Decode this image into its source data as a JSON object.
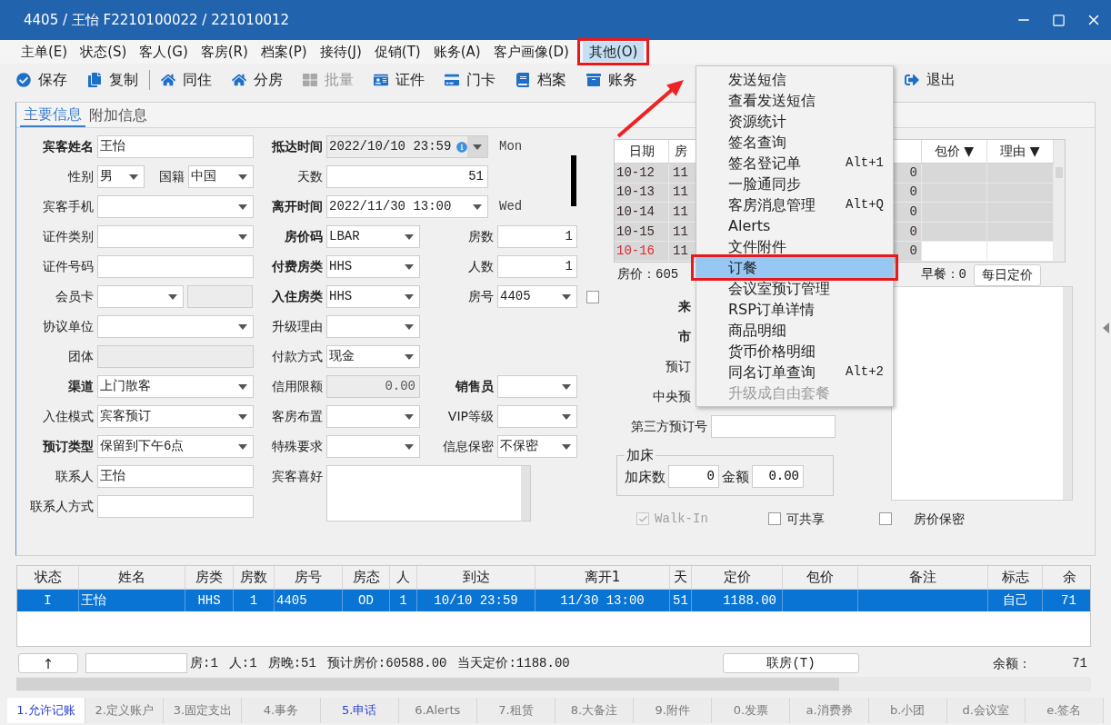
{
  "window": {
    "title": "4405 / 王怡 F2210100022 / 221010012"
  },
  "menu_bar": [
    {
      "label": "主单(E)",
      "selected": false,
      "callout": false
    },
    {
      "label": "状态(S)",
      "selected": false,
      "callout": false
    },
    {
      "label": "客人(G)",
      "selected": false,
      "callout": false
    },
    {
      "label": "客房(R)",
      "selected": false,
      "callout": false
    },
    {
      "label": "档案(P)",
      "selected": false,
      "callout": false
    },
    {
      "label": "接待(J)",
      "selected": false,
      "callout": false
    },
    {
      "label": "促销(T)",
      "selected": false,
      "callout": false
    },
    {
      "label": "账务(A)",
      "selected": false,
      "callout": false
    },
    {
      "label": "客户画像(D)",
      "selected": false,
      "callout": false
    },
    {
      "label": "其他(O)",
      "selected": true,
      "callout": true
    }
  ],
  "toolbar": [
    {
      "kind": "save",
      "label": "保存",
      "disabled": false,
      "separator_after": false
    },
    {
      "kind": "copy",
      "label": "复制",
      "disabled": false,
      "separator_after": true
    },
    {
      "kind": "share",
      "label": "同住",
      "disabled": false,
      "separator_after": false
    },
    {
      "kind": "split",
      "label": "分房",
      "disabled": false,
      "separator_after": false
    },
    {
      "kind": "batch",
      "label": "批量",
      "disabled": true,
      "separator_after": false
    },
    {
      "kind": "id",
      "label": "证件",
      "disabled": false,
      "separator_after": false
    },
    {
      "kind": "card",
      "label": "门卡",
      "disabled": false,
      "separator_after": false
    },
    {
      "kind": "files",
      "label": "档案",
      "disabled": false,
      "separator_after": false
    },
    {
      "kind": "account",
      "label": "账务",
      "disabled": false,
      "separator_after": false
    },
    {
      "kind": "exit",
      "label": "退出",
      "disabled": false,
      "separator_after": false
    }
  ],
  "dropdown": {
    "items": [
      {
        "label": "发送短信",
        "selected": false,
        "disabled": false,
        "callout": false
      },
      {
        "label": "查看发送短信",
        "selected": false,
        "disabled": false,
        "callout": false
      },
      {
        "label": "资源统计",
        "selected": false,
        "disabled": false,
        "callout": false
      },
      {
        "label": "签名查询",
        "selected": false,
        "disabled": false,
        "callout": false
      },
      {
        "label": "签名登记单",
        "shortcut": "Alt+1",
        "selected": false,
        "disabled": false,
        "callout": false
      },
      {
        "label": "一脸通同步",
        "selected": false,
        "disabled": false,
        "callout": false
      },
      {
        "label": "客房消息管理",
        "shortcut": "Alt+Q",
        "selected": false,
        "disabled": false,
        "callout": false
      },
      {
        "label": "Alerts",
        "selected": false,
        "disabled": false,
        "callout": false
      },
      {
        "label": "文件附件",
        "selected": false,
        "disabled": false,
        "callout": false
      },
      {
        "label": "订餐",
        "selected": true,
        "disabled": false,
        "callout": true
      },
      {
        "label": "会议室预订管理",
        "selected": false,
        "disabled": false,
        "callout": false
      },
      {
        "label": "RSP订单详情",
        "selected": false,
        "disabled": false,
        "callout": false
      },
      {
        "label": "商品明细",
        "selected": false,
        "disabled": false,
        "callout": false
      },
      {
        "label": "货币价格明细",
        "selected": false,
        "disabled": false,
        "callout": false
      },
      {
        "label": "同名订单查询",
        "shortcut": "Alt+2",
        "selected": false,
        "disabled": false,
        "callout": false
      },
      {
        "label": "升级成自由套餐",
        "selected": false,
        "disabled": true,
        "callout": false
      }
    ]
  },
  "annotation_arrow": true,
  "tabs": [
    {
      "label": "主要信息",
      "selected": true
    },
    {
      "label": "附加信息",
      "selected": false
    }
  ],
  "form": {
    "rows": [
      {
        "left": {
          "label": "宾客姓名",
          "bold": true,
          "fields": [
            {
              "kind": "text",
              "value": "王怡"
            }
          ]
        },
        "middle": {
          "label": "抵达时间",
          "bold": true,
          "fields": [
            {
              "kind": "date",
              "value": "2022/10/10 23:59",
              "disabled": true,
              "info": true
            }
          ],
          "suffix": "Mon"
        }
      },
      {
        "left": {
          "label": "性别",
          "bold": false,
          "fields": [
            {
              "kind": "select",
              "value": "男"
            },
            {
              "kind": "select",
              "value": "中国",
              "label": "国籍"
            }
          ]
        },
        "middle": {
          "label": "天数",
          "bold": false,
          "fields": [
            {
              "kind": "number",
              "value": "51"
            }
          ]
        }
      },
      {
        "left": {
          "label": "宾客手机",
          "bold": false,
          "fields": [
            {
              "kind": "select"
            }
          ]
        },
        "middle": {
          "label": "离开时间",
          "bold": true,
          "fields": [
            {
              "kind": "date",
              "value": "2022/11/30 13:00",
              "disabled": false,
              "info": false
            }
          ],
          "suffix": "Wed"
        }
      },
      {
        "left": {
          "label": "证件类别",
          "bold": false,
          "fields": [
            {
              "kind": "select"
            }
          ]
        },
        "middle": {
          "label": "房价码",
          "bold": true,
          "fields": [
            {
              "kind": "select",
              "value": "LBAR"
            }
          ]
        },
        "right": {
          "label": "房数",
          "bold": false,
          "fields": [
            {
              "kind": "number",
              "value": "1"
            }
          ]
        }
      },
      {
        "left": {
          "label": "证件号码",
          "bold": false,
          "fields": [
            {
              "kind": "text"
            }
          ]
        },
        "middle": {
          "label": "付费房类",
          "bold": true,
          "fields": [
            {
              "kind": "select",
              "value": "HHS"
            }
          ]
        },
        "right": {
          "label": "人数",
          "bold": false,
          "fields": [
            {
              "kind": "number",
              "value": "1"
            }
          ]
        }
      },
      {
        "left": {
          "label": "会员卡",
          "bold": false,
          "fields": [
            {
              "kind": "select"
            },
            {
              "kind": "readonly"
            }
          ]
        },
        "middle": {
          "label": "入住房类",
          "bold": true,
          "fields": [
            {
              "kind": "select",
              "value": "HHS"
            }
          ]
        },
        "right": {
          "label": "房号",
          "bold": false,
          "fields": [
            {
              "kind": "select",
              "value": "4405"
            },
            {
              "kind": "checkbox",
              "checked": false
            }
          ]
        }
      },
      {
        "left": {
          "label": "协议单位",
          "bold": false,
          "fields": [
            {
              "kind": "select"
            }
          ]
        },
        "middle": {
          "label": "升级理由",
          "bold": false,
          "fields": [
            {
              "kind": "select"
            }
          ]
        }
      },
      {
        "left": {
          "label": "团体",
          "bold": false,
          "fields": [
            {
              "kind": "readonly"
            }
          ]
        },
        "middle": {
          "label": "付款方式",
          "bold": false,
          "fields": [
            {
              "kind": "select",
              "value": "现金"
            }
          ]
        }
      },
      {
        "left": {
          "label": "渠道",
          "bold": true,
          "fields": [
            {
              "kind": "select",
              "value": "上门散客"
            }
          ]
        },
        "middle": {
          "label": "信用限额",
          "bold": false,
          "fields": [
            {
              "kind": "readonly",
              "value": "0.00"
            }
          ]
        },
        "right": {
          "label": "销售员",
          "bold": true,
          "fields": [
            {
              "kind": "select"
            }
          ]
        }
      },
      {
        "left": {
          "label": "入住模式",
          "bold": false,
          "fields": [
            {
              "kind": "select",
              "value": "宾客预订"
            }
          ]
        },
        "middle": {
          "label": "客房布置",
          "bold": false,
          "fields": [
            {
              "kind": "select"
            }
          ]
        },
        "right": {
          "label": "VIP等级",
          "bold": false,
          "fields": [
            {
              "kind": "select"
            }
          ]
        }
      },
      {
        "left": {
          "label": "预订类型",
          "bold": true,
          "fields": [
            {
              "kind": "select",
              "value": "保留到下午6点"
            }
          ]
        },
        "middle": {
          "label": "特殊要求",
          "bold": false,
          "fields": [
            {
              "kind": "select"
            }
          ]
        },
        "right": {
          "label": "信息保密",
          "bold": false,
          "fields": [
            {
              "kind": "select",
              "value": "不保密"
            }
          ]
        }
      },
      {
        "left": {
          "label": "联系人",
          "bold": false,
          "fields": [
            {
              "kind": "text",
              "value": "王怡"
            }
          ]
        },
        "middle": {
          "label": "宾客喜好",
          "bold": false,
          "fields": [
            {
              "kind": "textarea"
            }
          ]
        }
      },
      {
        "left": {
          "label": "联系人方式",
          "bold": false,
          "fields": [
            {
              "kind": "text"
            }
          ]
        }
      }
    ]
  },
  "date_grid": {
    "columns": [
      "日期",
      "房",
      "包价 ▼",
      "理由 ▼"
    ],
    "rows": [
      {
        "date": "10-12",
        "room": "11",
        "column_3": "0",
        "highlighted": false
      },
      {
        "date": "10-13",
        "room": "11",
        "column_3": "0",
        "highlighted": false
      },
      {
        "date": "10-14",
        "room": "11",
        "column_3": "0",
        "highlighted": false
      },
      {
        "date": "10-15",
        "room": "11",
        "column_3": "0",
        "highlighted": false
      },
      {
        "date": "10-16",
        "room": "11",
        "column_3": "0",
        "highlighted": true
      }
    ]
  },
  "rate_summary": {
    "rate": "房价：605",
    "breakfast": "早餐：0",
    "button": "每日定价"
  },
  "side_fields": [
    {
      "label": "来",
      "bold": true,
      "has_field": false
    },
    {
      "label": "市",
      "bold": true,
      "has_field": false
    },
    {
      "label": "预订",
      "bold": false,
      "has_field": false
    },
    {
      "label": "中央预",
      "bold": false,
      "has_field": false
    },
    {
      "label": "第三方预订号",
      "bold": false,
      "has_field": true
    }
  ],
  "extra_bed": {
    "title": "加床",
    "count_label": "加床数",
    "count": "0",
    "amount_label": "金额",
    "amount": "0.00"
  },
  "options": [
    {
      "label": "Walk-In",
      "checked": true,
      "disabled": true
    },
    {
      "label": "可共享",
      "checked": false,
      "disabled": false
    },
    {
      "label": "房价保密",
      "checked": false,
      "disabled": false
    }
  ],
  "room_table": {
    "columns": [
      "状态",
      "姓名",
      "房类",
      "房数",
      "房号",
      "房态",
      "人",
      "到达",
      "离开1",
      "天",
      "定价",
      "包价",
      "备注",
      "标志",
      "余"
    ],
    "rows": [
      {
        "selected": true,
        "cells": [
          "I",
          "王怡",
          "HHS",
          "1",
          "4405",
          "OD",
          "1",
          "10/10 23:59",
          "11/30 13:00",
          "51",
          "1188.00",
          "",
          "",
          "自己",
          "71"
        ]
      }
    ]
  },
  "footer": {
    "up_button": "↑",
    "summary": [
      "房:1",
      "人:1",
      "房晚:51",
      "预计房价:60588.00",
      "当天定价:1188.00"
    ],
    "link_button": "联房(T)",
    "balance_label": "余额：",
    "balance": "71"
  },
  "bottom_tabs": [
    {
      "label": "1.允许记账",
      "selected": true,
      "highlighted": true
    },
    {
      "label": "2.定义账户",
      "selected": false,
      "highlighted": false
    },
    {
      "label": "3.固定支出",
      "selected": false,
      "highlighted": false
    },
    {
      "label": "4.事务",
      "selected": false,
      "highlighted": false
    },
    {
      "label": "5.申话",
      "selected": false,
      "highlighted": true
    },
    {
      "label": "6.Alerts",
      "selected": false,
      "highlighted": false
    },
    {
      "label": "7.租赁",
      "selected": false,
      "highlighted": false
    },
    {
      "label": "8.大备注",
      "selected": false,
      "highlighted": false
    },
    {
      "label": "9.附件",
      "selected": false,
      "highlighted": false
    },
    {
      "label": "0.发票",
      "selected": false,
      "highlighted": false
    },
    {
      "label": "a.消费券",
      "selected": false,
      "highlighted": false
    },
    {
      "label": "b.小团",
      "selected": false,
      "highlighted": false
    },
    {
      "label": "d.会议室",
      "selected": false,
      "highlighted": false
    },
    {
      "label": "e.签名",
      "selected": false,
      "highlighted": false
    }
  ]
}
